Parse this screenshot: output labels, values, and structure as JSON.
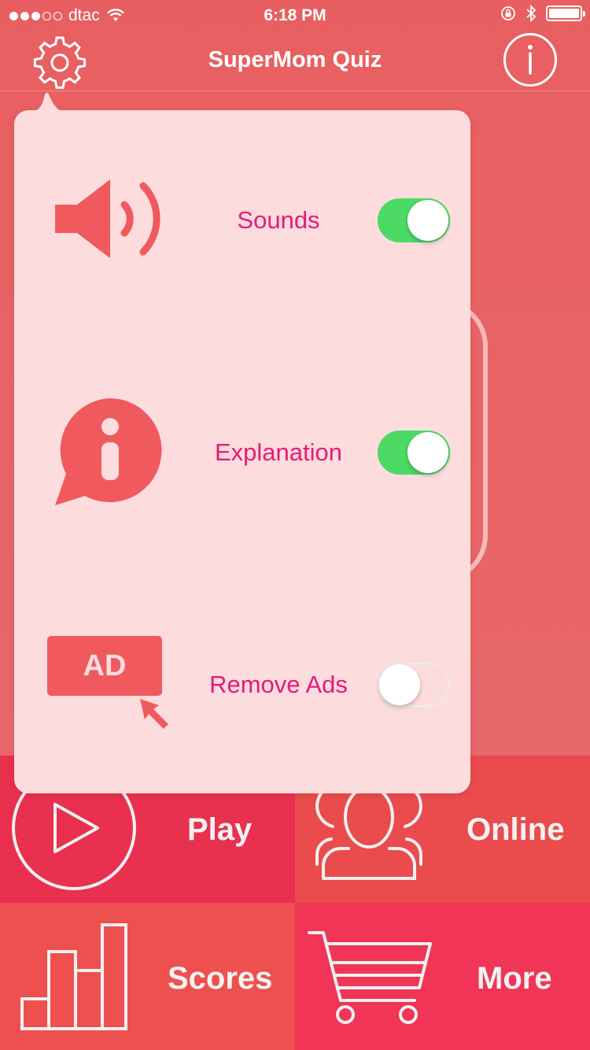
{
  "status_bar": {
    "carrier": "dtac",
    "time": "6:18 PM",
    "signal_icon": "signal-dots-icon",
    "wifi_icon": "wifi-icon",
    "lock_icon": "rotation-lock-icon",
    "bluetooth_icon": "bluetooth-icon",
    "battery_icon": "battery-icon"
  },
  "nav_bar": {
    "title": "SuperMom Quiz",
    "left_icon": "gear-icon",
    "right_icon": "info-icon"
  },
  "settings_popover": {
    "items": [
      {
        "label": "Sounds",
        "icon": "speaker-icon",
        "enabled": true
      },
      {
        "label": "Explanation",
        "icon": "info-bubble-icon",
        "enabled": true
      },
      {
        "label": "Remove Ads",
        "icon": "ad-cursor-icon",
        "enabled": false
      }
    ],
    "ad_badge_text": "AD"
  },
  "menu": {
    "play": {
      "label": "Play",
      "icon": "play-icon"
    },
    "online": {
      "label": "Online",
      "icon": "users-icon"
    },
    "scores": {
      "label": "Scores",
      "icon": "bar-chart-icon"
    },
    "more": {
      "label": "More",
      "icon": "cart-icon"
    }
  },
  "colors": {
    "background": "#e86264",
    "accent_text": "#e8197a",
    "toggle_on": "#4cd964",
    "popover": "#fcdcdc",
    "icon_red": "#f05a5e"
  }
}
